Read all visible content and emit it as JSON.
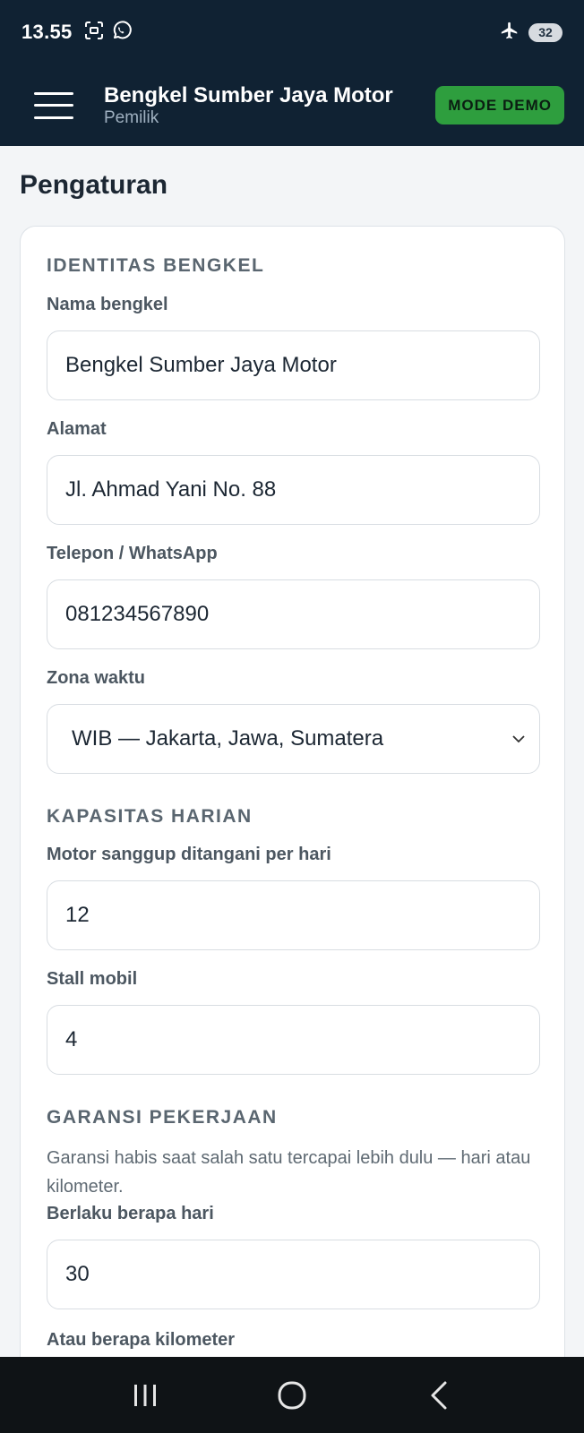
{
  "status_bar": {
    "time": "13.55",
    "battery": "32",
    "icons": [
      "screenshot-icon",
      "whatsapp-icon",
      "airplane-icon",
      "battery-icon"
    ]
  },
  "app_bar": {
    "title": "Bengkel Sumber Jaya Motor",
    "subtitle": "Pemilik",
    "demo_label": "MODE DEMO",
    "menu_icon": "hamburger-menu-icon"
  },
  "page": {
    "title": "Pengaturan"
  },
  "sections": {
    "identitas": {
      "title": "IDENTITAS BENGKEL",
      "nama_label": "Nama bengkel",
      "nama_value": "Bengkel Sumber Jaya Motor",
      "alamat_label": "Alamat",
      "alamat_value": "Jl. Ahmad Yani No. 88",
      "telepon_label": "Telepon / WhatsApp",
      "telepon_value": "081234567890",
      "zona_label": "Zona waktu",
      "zona_value": "WIB — Jakarta, Jawa, Sumatera"
    },
    "kapasitas": {
      "title": "KAPASITAS HARIAN",
      "motor_label": "Motor sanggup ditangani per hari",
      "motor_value": "12",
      "stall_label": "Stall mobil",
      "stall_value": "4"
    },
    "garansi": {
      "title": "GARANSI PEKERJAAN",
      "help": "Garansi habis saat salah satu tercapai lebih dulu — hari atau kilometer.",
      "hari_label": "Berlaku berapa hari",
      "hari_value": "30",
      "km_label": "Atau berapa kilometer"
    }
  },
  "nav_bar": {
    "icons": [
      "recent-apps-icon",
      "home-icon",
      "back-icon"
    ]
  },
  "colors": {
    "header_bg": "#102233",
    "demo_green": "#2e9e3e",
    "page_bg": "#f3f5f7"
  }
}
